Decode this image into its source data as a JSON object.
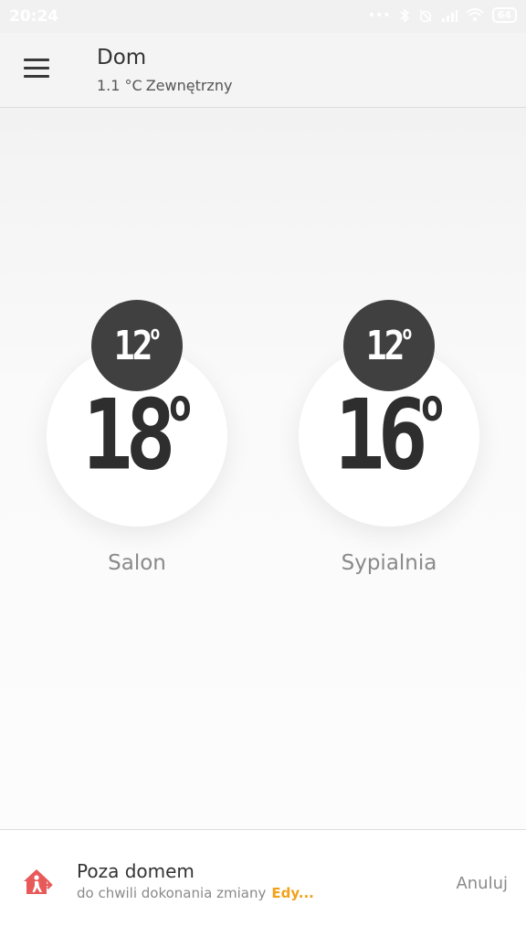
{
  "status_bar": {
    "time": "20:24",
    "battery": "64"
  },
  "header": {
    "title": "Dom",
    "outdoor_temp": "1.1 °C",
    "outdoor_label": "Zewnętrzny"
  },
  "rooms": [
    {
      "name": "Salon",
      "current": "18",
      "setpoint": "12",
      "degree": "o"
    },
    {
      "name": "Sypialnia",
      "current": "16",
      "setpoint": "12",
      "degree": "o"
    }
  ],
  "mode": {
    "title": "Poza domem",
    "subtitle": "do chwili dokonania zmiany",
    "edit_label": "Edy...",
    "cancel_label": "Anuluj",
    "accent_color": "#f2a21a",
    "icon_color": "#e85a5a"
  }
}
